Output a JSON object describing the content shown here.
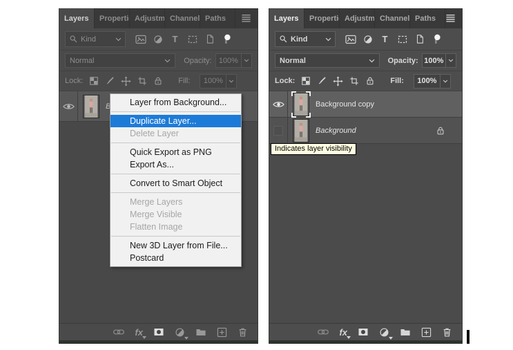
{
  "panel": {
    "tabs": [
      "Layers",
      "Propertie",
      "Adjustme",
      "Channels",
      "Paths"
    ],
    "filter": {
      "kind_label": "Kind"
    },
    "blend_mode_value": "Normal",
    "opacity_label": "Opacity:",
    "opacity_value": "100%",
    "lock_label": "Lock:",
    "fill_label": "Fill:",
    "fill_value": "100%",
    "fx_label": "fx",
    "type_icon_letter": "T"
  },
  "left_panel": {
    "layer_name": "Background"
  },
  "right_panel": {
    "layer1_name": "Background copy",
    "layer2_name": "Background"
  },
  "context_menu": {
    "items": [
      "Layer from Background...",
      "Duplicate Layer...",
      "Delete Layer",
      "Quick Export as PNG",
      "Export As...",
      "Convert to Smart Object",
      "Merge Layers",
      "Merge Visible",
      "Flatten Image",
      "New 3D Layer from File...",
      "Postcard"
    ],
    "highlighted_item": "Duplicate Layer...",
    "disabled_items": [
      "Delete Layer",
      "Merge Layers",
      "Merge Visible",
      "Flatten Image"
    ]
  },
  "tooltip": {
    "text": "Indicates layer visibility"
  },
  "colors": {
    "menu_highlight": "#1d7bd8",
    "tooltip_bg": "#ffffe1",
    "panel_bg": "#4d4d4d"
  }
}
